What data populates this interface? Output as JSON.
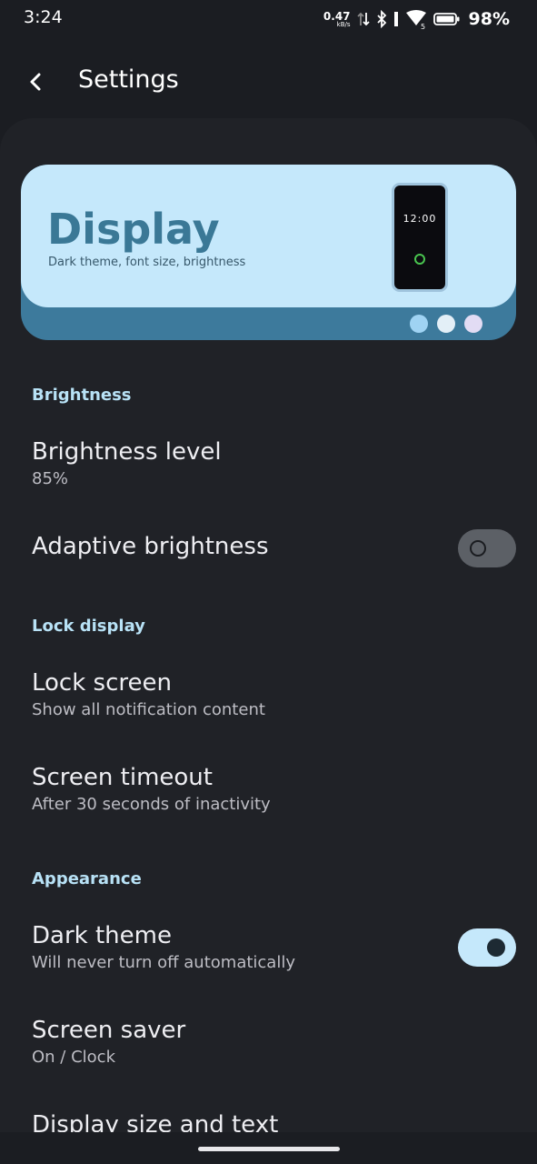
{
  "status": {
    "time": "3:24",
    "net_value": "0.47",
    "net_unit": "kB/s",
    "battery": "98%",
    "icons": [
      "data-arrows-icon",
      "bluetooth-icon",
      "vibrate-icon",
      "wifi-icon",
      "battery-icon"
    ]
  },
  "appbar": {
    "title": "Settings"
  },
  "hero": {
    "title": "Display",
    "subtitle": "Dark theme, font size, brightness",
    "phone_time": "12:00",
    "colors": {
      "top": "#c5e8fb",
      "base": "#3d7a9c",
      "dot1": "#9fd3f3",
      "dot2": "#e3eff7",
      "dot3": "#e2dcf4"
    }
  },
  "sections": {
    "brightness": "Brightness",
    "lock": "Lock display",
    "appearance": "Appearance"
  },
  "items": {
    "brightness_level": {
      "title": "Brightness level",
      "sub": "85%"
    },
    "adaptive": {
      "title": "Adaptive brightness",
      "checked": false
    },
    "lock_screen": {
      "title": "Lock screen",
      "sub": "Show all notification content"
    },
    "timeout": {
      "title": "Screen timeout",
      "sub": "After 30 seconds of inactivity"
    },
    "dark_theme": {
      "title": "Dark theme",
      "sub": "Will never turn off automatically",
      "checked": true
    },
    "screen_saver": {
      "title": "Screen saver",
      "sub": "On / Clock"
    },
    "display_size": {
      "title": "Display size and text"
    }
  }
}
